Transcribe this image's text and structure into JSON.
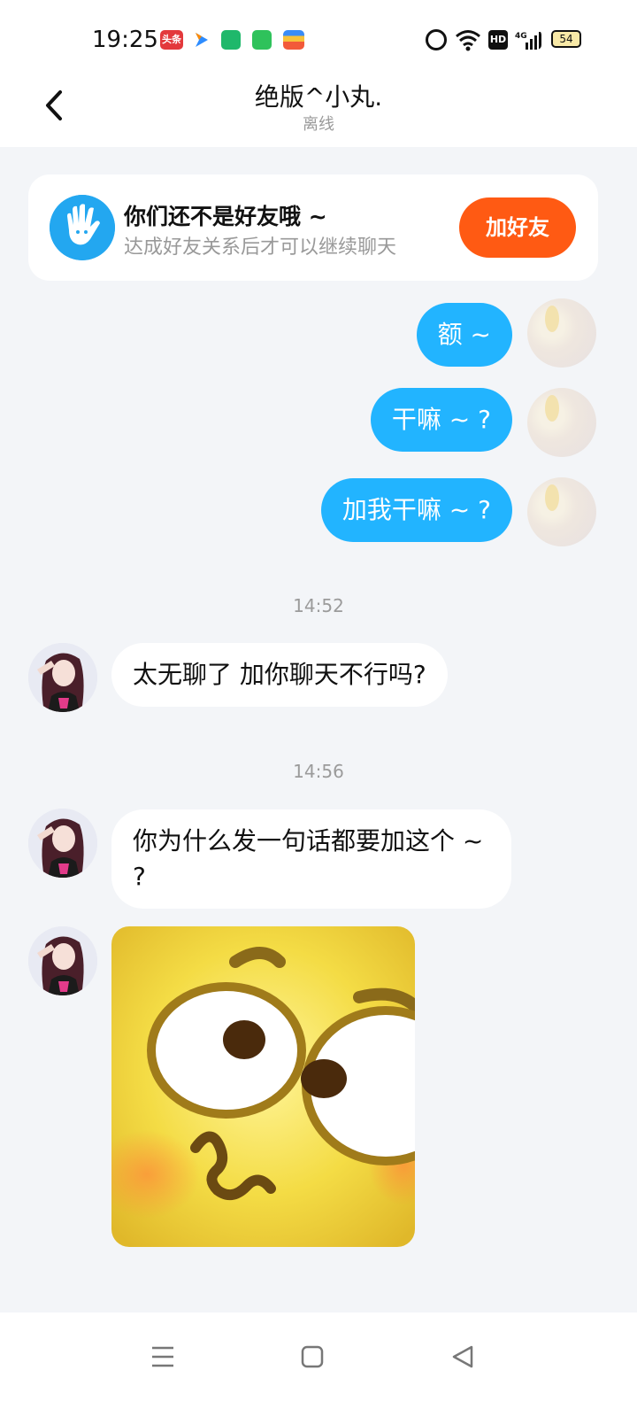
{
  "status_bar": {
    "time": "19:25",
    "battery": "54",
    "icons": [
      "toutiao-icon",
      "arrow-app-icon",
      "green-app-icon",
      "message-app-icon",
      "multicolor-app-icon",
      "alarm-icon",
      "wifi-icon",
      "hd-icon",
      "signal-4g-icon",
      "battery-icon"
    ],
    "toutiao_text": "头条",
    "hd_text": "HD",
    "network_text": "4G"
  },
  "header": {
    "title": "绝版^小丸.",
    "subtitle": "离线"
  },
  "banner": {
    "title": "你们还不是好友哦 ~",
    "subtitle": "达成好友关系后才可以继续聊天",
    "add_button": "加好友",
    "accent_color": "#ff5a13"
  },
  "messages": [
    {
      "side": "outgoing",
      "text": "额 ~"
    },
    {
      "side": "outgoing",
      "text": "干嘛 ~ ?"
    },
    {
      "side": "outgoing",
      "text": "加我干嘛 ~ ?"
    },
    {
      "side": "timestamp",
      "text": "14:52"
    },
    {
      "side": "incoming",
      "text": "太无聊了 加你聊天不行吗?"
    },
    {
      "side": "timestamp",
      "text": "14:56"
    },
    {
      "side": "incoming",
      "text": "你为什么发一句话都要加这个 ~ ?"
    },
    {
      "side": "incoming",
      "type": "sticker"
    }
  ],
  "colors": {
    "outgoing_bubble": "#22b4ff",
    "incoming_bubble": "#ffffff",
    "background": "#f3f5f8"
  },
  "navbar": {
    "icons": [
      "menu-icon",
      "home-icon",
      "back-triangle-icon"
    ]
  }
}
